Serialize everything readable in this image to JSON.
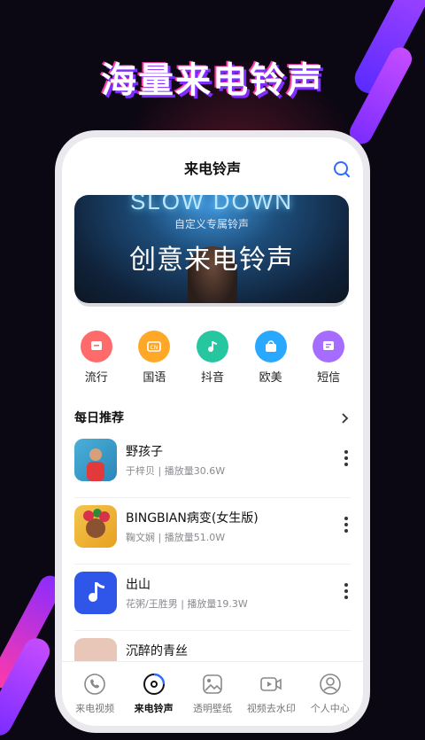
{
  "headline": "海量来电铃声",
  "topbar": {
    "title": "来电铃声"
  },
  "banner": {
    "neon_text": "SLOW DOWN",
    "subtitle": "自定义专属铃声",
    "title": "创意来电铃声"
  },
  "categories": [
    {
      "label": "流行",
      "color": "#ff6b6b",
      "icon": "message-icon"
    },
    {
      "label": "国语",
      "color": "#ffa726",
      "icon": "cn-icon"
    },
    {
      "label": "抖音",
      "color": "#26c6a0",
      "icon": "music-note-icon"
    },
    {
      "label": "欧美",
      "color": "#29a8ff",
      "icon": "bag-icon"
    },
    {
      "label": "短信",
      "color": "#a66bff",
      "icon": "sms-icon"
    }
  ],
  "section": {
    "title": "每日推荐"
  },
  "songs": [
    {
      "name": "野孩子",
      "meta": "于梓贝 | 播放量30.6W"
    },
    {
      "name": "BINGBIAN病变(女生版)",
      "meta": "鞠文娴 | 播放量51.0W"
    },
    {
      "name": "出山",
      "meta": "花粥/王胜男 | 播放量19.3W"
    },
    {
      "name": "沉醉的青丝",
      "meta": ""
    }
  ],
  "tabs": [
    {
      "label": "来电视频",
      "icon": "phone-icon"
    },
    {
      "label": "来电铃声",
      "icon": "disc-icon",
      "active": true
    },
    {
      "label": "透明壁纸",
      "icon": "image-icon"
    },
    {
      "label": "视频去水印",
      "icon": "video-icon"
    },
    {
      "label": "个人中心",
      "icon": "user-icon"
    }
  ]
}
